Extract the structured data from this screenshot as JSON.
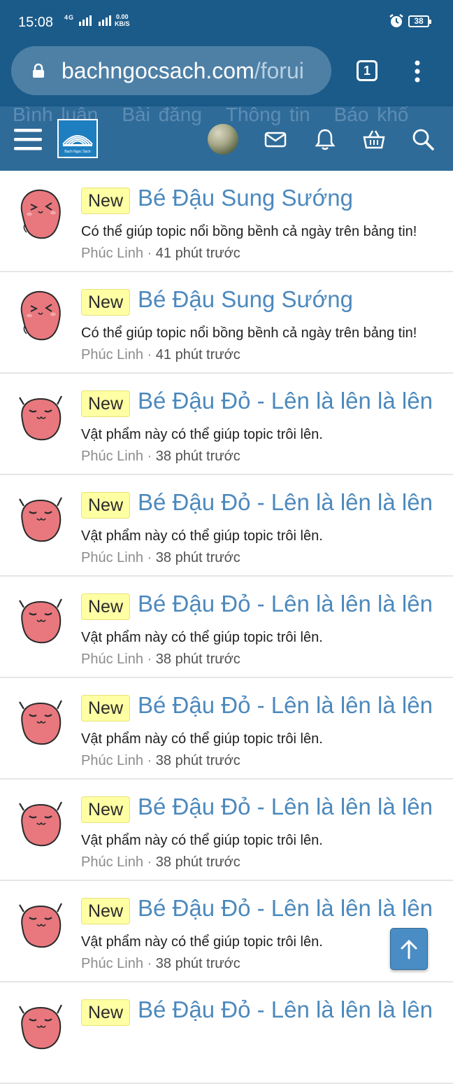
{
  "status_bar": {
    "time": "15:08",
    "network": "4G",
    "speed_top": "0.00",
    "speed_unit": "KB/S",
    "battery": "38"
  },
  "browser": {
    "url_main": "bachngocsach.com",
    "url_tail": "/forui",
    "tab_count": "1"
  },
  "forum_header": {
    "ghost_tabs": [
      "Bình luận",
      "Bài đăng",
      "Thông tin",
      "Báo khổ"
    ],
    "logo_text": "Bạch Ngọc Sách",
    "icons": [
      "menu-icon",
      "envelope-icon",
      "bell-icon",
      "basket-icon",
      "search-icon"
    ]
  },
  "items": [
    {
      "badge": "New",
      "title": "Bé Đậu Sung Sướng",
      "desc": "Có thể giúp topic nổi bồng bềnh cả ngày trên bảng tin!",
      "author": "Phúc Linh",
      "sep": "·",
      "time": "41 phút trước",
      "character": "happy"
    },
    {
      "badge": "New",
      "title": "Bé Đậu Sung Sướng",
      "desc": "Có thể giúp topic nổi bồng bềnh cả ngày trên bảng tin!",
      "author": "Phúc Linh",
      "sep": "·",
      "time": "41 phút trước",
      "character": "happy"
    },
    {
      "badge": "New",
      "title": "Bé Đậu Đỏ - Lên là lên là lên",
      "desc": "Vật phẩm này có thể giúp topic trôi lên.",
      "author": "Phúc Linh",
      "sep": "·",
      "time": "38 phút trước",
      "character": "red"
    },
    {
      "badge": "New",
      "title": "Bé Đậu Đỏ - Lên là lên là lên",
      "desc": "Vật phẩm này có thể giúp topic trôi lên.",
      "author": "Phúc Linh",
      "sep": "·",
      "time": "38 phút trước",
      "character": "red"
    },
    {
      "badge": "New",
      "title": "Bé Đậu Đỏ - Lên là lên là lên",
      "desc": "Vật phẩm này có thể giúp topic trôi lên.",
      "author": "Phúc Linh",
      "sep": "·",
      "time": "38 phút trước",
      "character": "red"
    },
    {
      "badge": "New",
      "title": "Bé Đậu Đỏ - Lên là lên là lên",
      "desc": "Vật phẩm này có thể giúp topic trôi lên.",
      "author": "Phúc Linh",
      "sep": "·",
      "time": "38 phút trước",
      "character": "red"
    },
    {
      "badge": "New",
      "title": "Bé Đậu Đỏ - Lên là lên là lên",
      "desc": "Vật phẩm này có thể giúp topic trôi lên.",
      "author": "Phúc Linh",
      "sep": "·",
      "time": "38 phút trước",
      "character": "red"
    },
    {
      "badge": "New",
      "title": "Bé Đậu Đỏ - Lên là lên là lên",
      "desc": "Vật phẩm này có thể giúp topic trôi lên.",
      "author": "Phúc Linh",
      "sep": "·",
      "time": "38 phút trước",
      "character": "red"
    },
    {
      "badge": "New",
      "title": "Bé Đậu Đỏ - Lên là lên là lên",
      "desc": "",
      "author": "",
      "sep": "",
      "time": "",
      "character": "red"
    }
  ],
  "colors": {
    "header_dark": "#1b5b8a",
    "header": "#2f6b98",
    "title_link": "#4c89bd",
    "badge_bg": "#ffffa3",
    "bean": "#e8787e"
  }
}
